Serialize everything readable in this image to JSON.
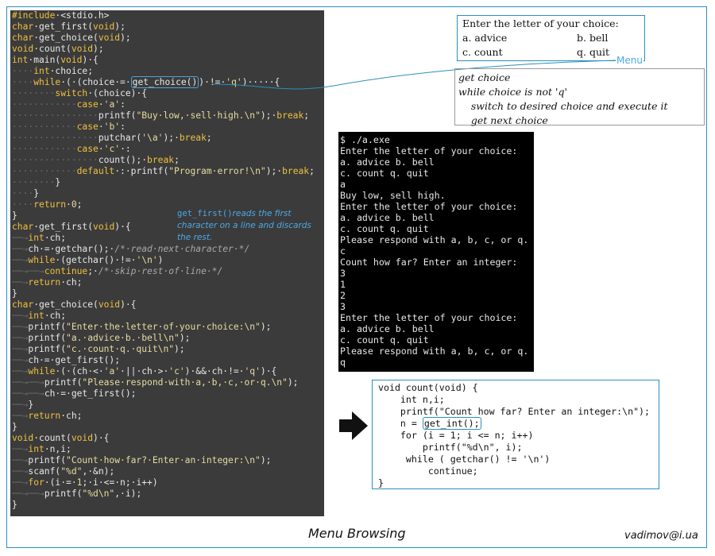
{
  "editor": {
    "lines": [
      [
        [
          "kw",
          "#include"
        ],
        [
          "",
          "·<stdio.h>"
        ]
      ],
      [
        [
          "kw",
          "char"
        ],
        [
          "",
          "·get_first("
        ],
        [
          "kw",
          "void"
        ],
        [
          "",
          ");"
        ]
      ],
      [
        [
          "kw",
          "char"
        ],
        [
          "",
          "·get_choice("
        ],
        [
          "kw",
          "void"
        ],
        [
          "",
          ");"
        ]
      ],
      [
        [
          "kw",
          "void"
        ],
        [
          "",
          "·count("
        ],
        [
          "kw",
          "void"
        ],
        [
          "",
          ");"
        ]
      ],
      [
        [
          "kw",
          "int"
        ],
        [
          "",
          "·main("
        ],
        [
          "kw",
          "void"
        ],
        [
          "",
          ")·{"
        ]
      ],
      [
        [
          "ws",
          "····"
        ],
        [
          "kw",
          "int"
        ],
        [
          "",
          "·choice;"
        ]
      ],
      [
        [
          "ws",
          "····"
        ],
        [
          "kw",
          "while"
        ],
        [
          "",
          "·(·(choice·=·"
        ],
        [
          "hl",
          "get_choice()"
        ],
        [
          "",
          ")·!=·"
        ],
        [
          "str",
          "'q'"
        ],
        [
          "",
          ")·····{"
        ]
      ],
      [
        [
          "ws",
          "········"
        ],
        [
          "kw",
          "switch"
        ],
        [
          "",
          "·(choice)·{"
        ]
      ],
      [
        [
          "ws",
          "············"
        ],
        [
          "kw",
          "case"
        ],
        [
          "",
          "·"
        ],
        [
          "str",
          "'a'"
        ],
        [
          "",
          ":"
        ]
      ],
      [
        [
          "ws",
          "················"
        ],
        [
          "",
          "printf("
        ],
        [
          "str",
          "\"Buy·low,·sell·high.\\n\""
        ],
        [
          "",
          ");·"
        ],
        [
          "kw",
          "break"
        ],
        [
          "",
          ";"
        ]
      ],
      [
        [
          "ws",
          "············"
        ],
        [
          "kw",
          "case"
        ],
        [
          "",
          "·"
        ],
        [
          "str",
          "'b'"
        ],
        [
          "",
          ":"
        ]
      ],
      [
        [
          "ws",
          "················"
        ],
        [
          "",
          "putchar("
        ],
        [
          "str",
          "'\\a'"
        ],
        [
          "",
          ");·"
        ],
        [
          "kw",
          "break"
        ],
        [
          "",
          ";"
        ]
      ],
      [
        [
          "ws",
          "············"
        ],
        [
          "kw",
          "case"
        ],
        [
          "",
          "·"
        ],
        [
          "str",
          "'c'"
        ],
        [
          "",
          "·:"
        ]
      ],
      [
        [
          "ws",
          "················"
        ],
        [
          "",
          "count();·"
        ],
        [
          "kw",
          "break"
        ],
        [
          "",
          ";"
        ]
      ],
      [
        [
          "ws",
          "············"
        ],
        [
          "kw",
          "default"
        ],
        [
          "",
          "·:·printf("
        ],
        [
          "str",
          "\"Program·error!\\n\""
        ],
        [
          "",
          ");·"
        ],
        [
          "kw",
          "break"
        ],
        [
          "",
          ";"
        ]
      ],
      [
        [
          "ws",
          "········"
        ],
        [
          "",
          "}"
        ]
      ],
      [
        [
          "ws",
          "····"
        ],
        [
          "",
          "}"
        ]
      ],
      [
        [
          "ws",
          "····"
        ],
        [
          "kw",
          "return"
        ],
        [
          "",
          "·"
        ],
        [
          "num",
          "0"
        ],
        [
          "",
          ";"
        ]
      ],
      [
        [
          "",
          "}"
        ]
      ],
      [
        [
          "kw",
          "char"
        ],
        [
          "",
          "·get_first("
        ],
        [
          "kw",
          "void"
        ],
        [
          "",
          ")·{"
        ]
      ],
      [
        [
          "ws",
          "──→"
        ],
        [
          "kw",
          "int"
        ],
        [
          "",
          "·ch;"
        ]
      ],
      [
        [
          "ws",
          "──→"
        ],
        [
          "",
          "ch·=·getchar();·"
        ],
        [
          "cmt",
          "/*·read·next·character·*/"
        ]
      ],
      [
        [
          "ws",
          "──→"
        ],
        [
          "kw",
          "while"
        ],
        [
          "",
          "·(getchar()·!=·"
        ],
        [
          "str",
          "'\\n'"
        ],
        [
          "",
          ")"
        ]
      ],
      [
        [
          "ws",
          "──→──→"
        ],
        [
          "kw",
          "continue"
        ],
        [
          "",
          ";·"
        ],
        [
          "cmt",
          "/*·skip·rest·of·line·*/"
        ]
      ],
      [
        [
          "ws",
          "──→"
        ],
        [
          "kw",
          "return"
        ],
        [
          "",
          "·ch;"
        ]
      ],
      [
        [
          "",
          "}"
        ]
      ],
      [
        [
          "kw",
          "char"
        ],
        [
          "",
          "·get_choice("
        ],
        [
          "kw",
          "void"
        ],
        [
          "",
          ")·{"
        ]
      ],
      [
        [
          "ws",
          "──→"
        ],
        [
          "kw",
          "int"
        ],
        [
          "",
          "·ch;"
        ]
      ],
      [
        [
          "ws",
          "──→"
        ],
        [
          "",
          "printf("
        ],
        [
          "str",
          "\"Enter·the·letter·of·your·choice:\\n\""
        ],
        [
          "",
          ");"
        ]
      ],
      [
        [
          "ws",
          "──→"
        ],
        [
          "",
          "printf("
        ],
        [
          "str",
          "\"a.·advice·b.·bell\\n\""
        ],
        [
          "",
          ");"
        ]
      ],
      [
        [
          "ws",
          "──→"
        ],
        [
          "",
          "printf("
        ],
        [
          "str",
          "\"c.·count·q.·quit\\n\""
        ],
        [
          "",
          ");"
        ]
      ],
      [
        [
          "ws",
          "──→"
        ],
        [
          "",
          "ch·=·get_first();"
        ]
      ],
      [
        [
          "ws",
          "──→"
        ],
        [
          "kw",
          "while"
        ],
        [
          "",
          "·(·(ch·<·"
        ],
        [
          "str",
          "'a'"
        ],
        [
          "",
          "·||·ch·>·"
        ],
        [
          "str",
          "'c'"
        ],
        [
          "",
          ")·&&·ch·!=·"
        ],
        [
          "str",
          "'q'"
        ],
        [
          "",
          ")·{"
        ]
      ],
      [
        [
          "ws",
          "──→──→"
        ],
        [
          "",
          "printf("
        ],
        [
          "str",
          "\"Please·respond·with·a,·b,·c,·or·q.\\n\""
        ],
        [
          "",
          ");"
        ]
      ],
      [
        [
          "ws",
          "──→──→"
        ],
        [
          "",
          "ch·=·get_first();"
        ]
      ],
      [
        [
          "ws",
          "──→"
        ],
        [
          "",
          "}"
        ]
      ],
      [
        [
          "ws",
          "──→"
        ],
        [
          "kw",
          "return"
        ],
        [
          "",
          "·ch;"
        ]
      ],
      [
        [
          "",
          "}"
        ]
      ],
      [
        [
          "kw",
          "void"
        ],
        [
          "",
          "·count("
        ],
        [
          "kw",
          "void"
        ],
        [
          "",
          ")·{"
        ]
      ],
      [
        [
          "ws",
          "──→"
        ],
        [
          "kw",
          "int"
        ],
        [
          "",
          "·n,i;"
        ]
      ],
      [
        [
          "ws",
          "──→"
        ],
        [
          "",
          "printf("
        ],
        [
          "str",
          "\"Count·how·far?·Enter·an·integer:\\n\""
        ],
        [
          "",
          ");"
        ]
      ],
      [
        [
          "ws",
          "──→"
        ],
        [
          "",
          "scanf("
        ],
        [
          "str",
          "\"%d\""
        ],
        [
          "",
          ",·&n);"
        ]
      ],
      [
        [
          "ws",
          "──→"
        ],
        [
          "kw",
          "for"
        ],
        [
          "",
          "·(i·=·"
        ],
        [
          "num",
          "1"
        ],
        [
          "",
          ";·i·<=·n;·i++)"
        ]
      ],
      [
        [
          "ws",
          "──→──→"
        ],
        [
          "",
          "printf("
        ],
        [
          "str",
          "\"%d\\n\""
        ],
        [
          "",
          ",·i);"
        ]
      ],
      [
        [
          "",
          "}"
        ]
      ]
    ],
    "note_func": "get_first()",
    "note_text": "reads the first character on a line and discards the rest."
  },
  "menu": {
    "title": "Enter the letter of your choice:",
    "opt_a": "a. advice",
    "opt_b": "b. bell",
    "opt_c": "c. count",
    "opt_q": "q. quit",
    "label": "Menu"
  },
  "pseudo": {
    "lines": [
      "get choice",
      "while choice is not 'q'",
      "    switch to desired choice and execute it",
      "    get next choice"
    ]
  },
  "terminal": {
    "lines": [
      "$ ./a.exe",
      "Enter the letter of your choice:",
      "a. advice b. bell",
      "c. count q. quit",
      "a",
      "Buy low, sell high.",
      "Enter the letter of your choice:",
      "a. advice b. bell",
      "c. count q. quit",
      "Please respond with a, b, c, or q.",
      "c",
      "Count how far? Enter an integer:",
      "3",
      "1",
      "2",
      "3",
      "Enter the letter of your choice:",
      "a. advice b. bell",
      "c. count q. quit",
      "Please respond with a, b, c, or q.",
      "q"
    ]
  },
  "count_func": {
    "l1": "void count(void) {",
    "l2": "    int n,i;",
    "l3": "    printf(\"Count how far? Enter an integer:\\n\");",
    "l4_pre": "    n = ",
    "l4_hl": "get_int();",
    "l5": "    for (i = 1; i <= n; i++)",
    "l6": "        printf(\"%d\\n\", i);",
    "l7": "     while ( getchar() != '\\n')",
    "l8": "         continue;",
    "l9": "}"
  },
  "caption": "Menu Browsing",
  "author": "vadimov@i.ua",
  "colors": {
    "accent": "#2a8fbf",
    "note": "#4aa8e8",
    "editor_bg": "#3b3b3b",
    "keyword": "#f0c040"
  },
  "icons": {
    "arrow": "right-arrow-icon"
  }
}
